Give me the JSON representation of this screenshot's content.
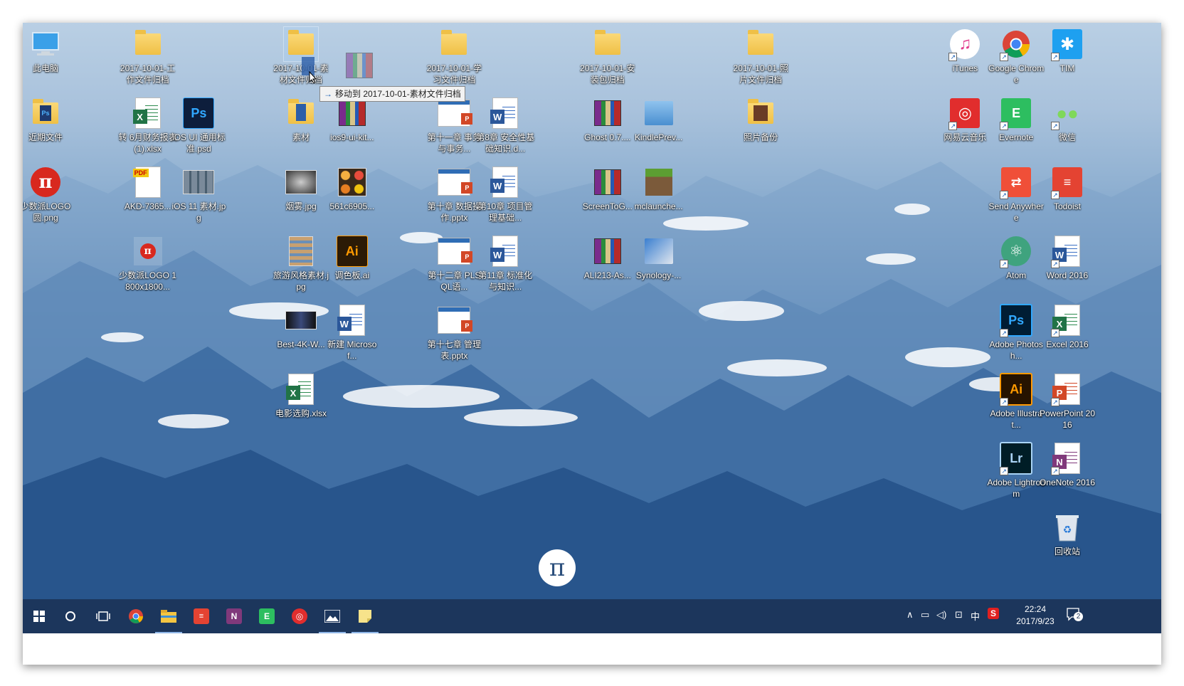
{
  "desktop_icons": [
    {
      "label": "此电脑",
      "kind": "computer"
    },
    {
      "label": "近期文件",
      "kind": "folder-ps"
    },
    {
      "label": "少数派LOGO圆.png",
      "kind": "pi-red"
    },
    {
      "label": "2017-10-01-工作文件归档",
      "kind": "folder"
    },
    {
      "label": "转 6月财务报表 (1).xlsx",
      "kind": "excel"
    },
    {
      "label": "AKD-7365...",
      "kind": "pdf"
    },
    {
      "label": "少数派LOGO 1800x1800...",
      "kind": "pi-small"
    },
    {
      "label": "iOS UI 通用标准.psd",
      "kind": "psd"
    },
    {
      "label": "iOS 11 素材.jpg",
      "kind": "grid-img"
    },
    {
      "label": "2017-10-01-素材文件归档",
      "kind": "folder",
      "selected": true
    },
    {
      "label": "素材",
      "kind": "folder-doc"
    },
    {
      "label": "烟雾.jpg",
      "kind": "smoke"
    },
    {
      "label": "旅游风格素材.jpg",
      "kind": "travel"
    },
    {
      "label": "Best-4K-W...",
      "kind": "dark-img"
    },
    {
      "label": "电影选购.xlsx",
      "kind": "excel"
    },
    {
      "label": "ios9-ui-kit...",
      "kind": "rar"
    },
    {
      "label": "561c6905...",
      "kind": "emoji-img"
    },
    {
      "label": "调色板.ai",
      "kind": "ai"
    },
    {
      "label": "新建 Microsof...",
      "kind": "word-doc"
    },
    {
      "label": "2017-10-01-学习文件归档",
      "kind": "folder"
    },
    {
      "label": "第十一章 事务与事务...",
      "kind": "ppt"
    },
    {
      "label": "第十章 数据操作.pptx",
      "kind": "ppt"
    },
    {
      "label": "第十二章 PLSQL语...",
      "kind": "ppt"
    },
    {
      "label": "第十七章 管理表.pptx",
      "kind": "ppt"
    },
    {
      "label": "第8章 安全性基础知识.d...",
      "kind": "word-doc"
    },
    {
      "label": "第10章 项目管理基础...",
      "kind": "word-doc"
    },
    {
      "label": "第11章 标准化与知识...",
      "kind": "word-doc"
    },
    {
      "label": "2017-10-01-安装包归档",
      "kind": "folder"
    },
    {
      "label": "Ghost 0.7....",
      "kind": "rar"
    },
    {
      "label": "ScreenToG...",
      "kind": "rar"
    },
    {
      "label": "ALI213-As...",
      "kind": "rar"
    },
    {
      "label": "KindlePrev...",
      "kind": "kindle"
    },
    {
      "label": "mclaunche...",
      "kind": "minecraft"
    },
    {
      "label": "Synology-...",
      "kind": "synology"
    },
    {
      "label": "2017-10-01-照片文件归档",
      "kind": "folder"
    },
    {
      "label": "照片备份",
      "kind": "folder-photo"
    },
    {
      "label": "iTunes",
      "kind": "itunes"
    },
    {
      "label": "网易云音乐",
      "kind": "netease"
    },
    {
      "label": "Google Chrome",
      "kind": "chrome"
    },
    {
      "label": "Evernote",
      "kind": "evernote"
    },
    {
      "label": "Send Anywhere",
      "kind": "send-anywhere"
    },
    {
      "label": "Atom",
      "kind": "atom"
    },
    {
      "label": "Adobe Photosh...",
      "kind": "app-ps"
    },
    {
      "label": "Adobe Illustrat...",
      "kind": "app-ai"
    },
    {
      "label": "Adobe Lightroom",
      "kind": "app-lr"
    },
    {
      "label": "TIM",
      "kind": "tim"
    },
    {
      "label": "微信",
      "kind": "wechat"
    },
    {
      "label": "Todoist",
      "kind": "todoist"
    },
    {
      "label": "Word 2016",
      "kind": "app-word"
    },
    {
      "label": "Excel 2016",
      "kind": "app-excel"
    },
    {
      "label": "PowerPoint 2016",
      "kind": "app-ppt"
    },
    {
      "label": "OneNote 2016",
      "kind": "app-onenote"
    },
    {
      "label": "回收站",
      "kind": "recycle-bin"
    }
  ],
  "drag": {
    "ghost_label": "素材",
    "move_tooltip": "移动到 2017-10-01-素材文件归档",
    "ghost_extra_1": "烟雾.jpg",
    "ghost_extra_2": "561c6905..."
  },
  "taskbar": {
    "items": [
      "start",
      "cortana",
      "task-view",
      "chrome",
      "file-explorer",
      "todoist",
      "onenote",
      "evernote",
      "netease-music",
      "photos",
      "sticky-notes"
    ],
    "active": [
      "file-explorer",
      "photos",
      "sticky-notes"
    ],
    "tray": {
      "ime": "中",
      "antivirus": "S",
      "notification_count": "2"
    },
    "time": "22:24",
    "date": "2017/9/23"
  },
  "colors": {
    "taskbar": "#1c3458",
    "tooltip_bg": "#f2f2f2",
    "accent": "#1a5fb4"
  }
}
